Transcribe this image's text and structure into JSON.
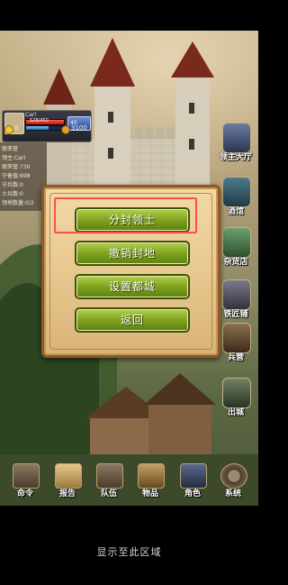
{
  "player": {
    "name": "Carl",
    "hp_text": "528/450",
    "hp_fraction": 1.0,
    "exp_fraction": 0.6,
    "shield_text": "40",
    "gold": "0",
    "coins": "3100"
  },
  "info": [
    "联荣誉",
    "领主:Carl",
    "联荣誉:730",
    "守备值:698",
    "守兵数:0",
    "士兵数:0",
    "领地数量:0/2"
  ],
  "side_menu": [
    {
      "label": "领主大厅",
      "icon": "castle-hall-icon"
    },
    {
      "label": "酒馆",
      "icon": "tavern-icon"
    },
    {
      "label": "杂货店",
      "icon": "shop-icon"
    },
    {
      "label": "铁匠铺",
      "icon": "anvil-icon"
    },
    {
      "label": "兵营",
      "icon": "barracks-icon"
    },
    {
      "label": "出城",
      "icon": "gate-icon"
    }
  ],
  "dialog": {
    "buttons": [
      "分封领土",
      "撤销封地",
      "设置都城",
      "返回"
    ]
  },
  "bottom_menu": [
    {
      "label": "命令",
      "icon": "command-icon"
    },
    {
      "label": "报告",
      "icon": "scroll-icon"
    },
    {
      "label": "队伍",
      "icon": "team-icon"
    },
    {
      "label": "物品",
      "icon": "bag-icon"
    },
    {
      "label": "角色",
      "icon": "character-icon"
    },
    {
      "label": "系统",
      "icon": "gear-icon"
    }
  ],
  "footer": {
    "hint": "显示至此区域"
  }
}
